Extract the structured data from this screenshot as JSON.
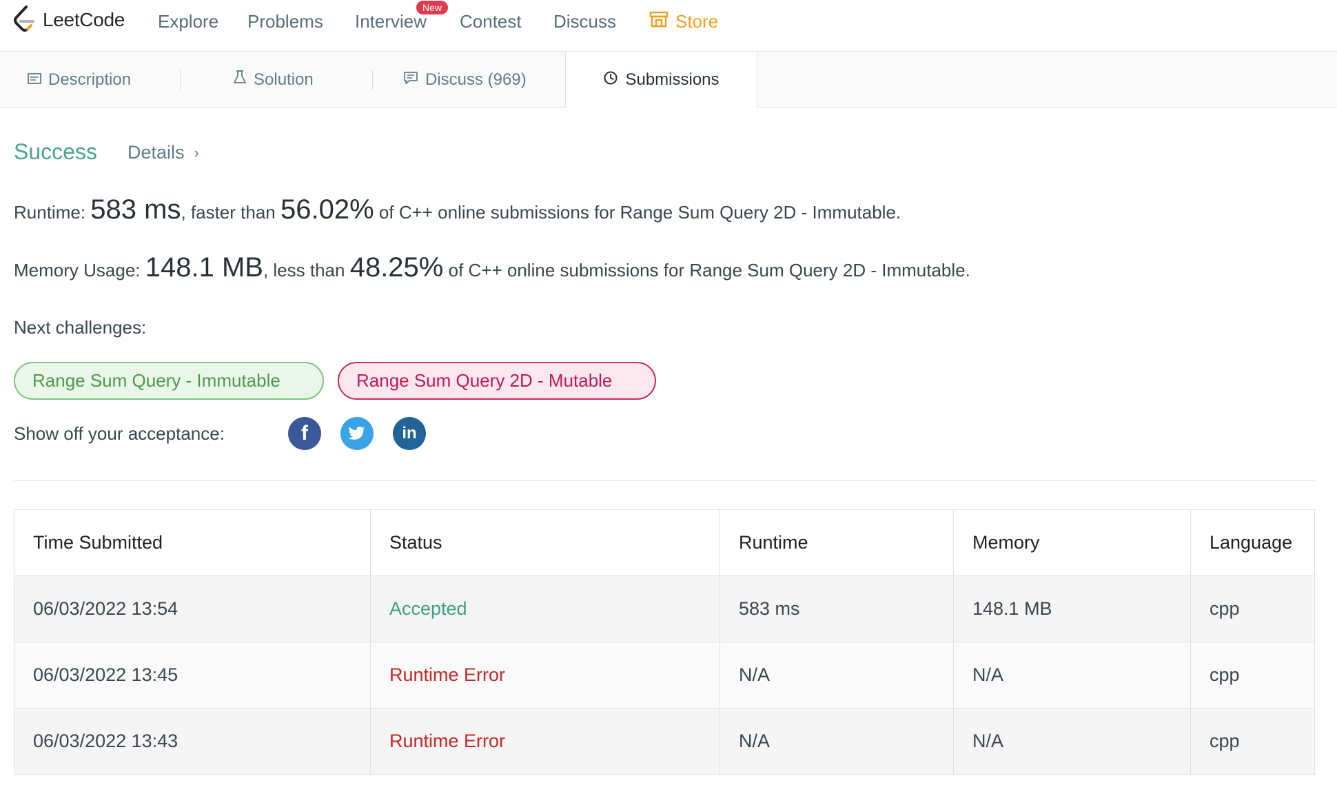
{
  "nav": {
    "logo_text": "LeetCode",
    "items": [
      "Explore",
      "Problems",
      "Interview",
      "Contest",
      "Discuss"
    ],
    "store_label": "Store",
    "new_badge": "New"
  },
  "tabs": {
    "description": "Description",
    "solution": "Solution",
    "discuss": "Discuss (969)",
    "submissions": "Submissions"
  },
  "result": {
    "status": "Success",
    "details_label": "Details",
    "runtime_label": "Runtime:",
    "runtime_value": "583 ms",
    "runtime_compare": ", faster than",
    "runtime_percent": "56.02%",
    "runtime_suffix": "of C++ online submissions for Range Sum Query 2D - Immutable.",
    "memory_label": "Memory Usage:",
    "memory_value": "148.1 MB",
    "memory_compare": ", less than",
    "memory_percent": "48.25%",
    "memory_suffix": "of C++ online submissions for Range Sum Query 2D - Immutable.",
    "next_label": "Next challenges:",
    "challenges": [
      "Range Sum Query - Immutable",
      "Range Sum Query 2D - Mutable"
    ],
    "showoff_label": "Show off your acceptance:"
  },
  "table": {
    "headers": [
      "Time Submitted",
      "Status",
      "Runtime",
      "Memory",
      "Language"
    ],
    "rows": [
      [
        "06/03/2022 13:54",
        "Accepted",
        "583 ms",
        "148.1 MB",
        "cpp"
      ],
      [
        "06/03/2022 13:45",
        "Runtime Error",
        "N/A",
        "N/A",
        "cpp"
      ],
      [
        "06/03/2022 13:43",
        "Runtime Error",
        "N/A",
        "N/A",
        "cpp"
      ]
    ]
  },
  "colors": {
    "accepted": "#3f9e84",
    "error": "#c62828",
    "store": "#f0a020",
    "success": "#4aa391"
  },
  "icons": [
    "leetcode-logo-icon",
    "store-icon",
    "description-icon",
    "solution-flask-icon",
    "discuss-icon",
    "clock-icon",
    "chevron-right-icon",
    "facebook-icon",
    "twitter-icon",
    "linkedin-icon"
  ]
}
